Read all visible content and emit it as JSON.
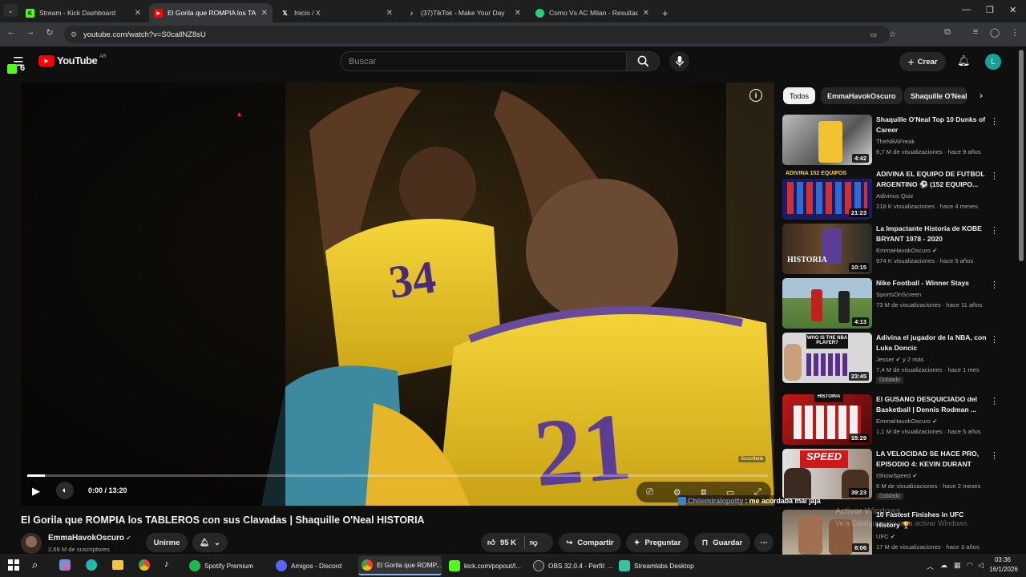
{
  "browser": {
    "tabs": [
      {
        "title": "Stream - Kick Dashboard",
        "icon": "kick-icon",
        "color": "#53fc18"
      },
      {
        "title": "El Gorila que ROMPIA los TABLE",
        "icon": "youtube-icon",
        "color": "#ff0000"
      },
      {
        "title": "Inicio / X",
        "icon": "x-icon",
        "color": "#ffffff"
      },
      {
        "title": "(37)TikTok - Make Your Day",
        "icon": "tiktok-icon",
        "color": "#ffffff"
      },
      {
        "title": "Como Vs AC Milan - Resultado",
        "icon": "soccer-icon",
        "color": "#2ecc71"
      }
    ],
    "url": "youtube.com/watch?v=S0callNZ8sU"
  },
  "youtube": {
    "logo_text": "YouTube",
    "region": "AR",
    "kick_badge": "6",
    "search_placeholder": "Buscar",
    "create_label": "Crear",
    "avatar_letter": "L"
  },
  "player": {
    "time": "0:00 / 13:20",
    "subscribe_watermark": "Suscribete"
  },
  "video": {
    "title": "El Gorila que ROMPIA los TABLEROS con sus Clavadas | Shaquille O'Neal HISTORIA",
    "channel": "EmmaHavokOscuro",
    "subscribers": "2,69 M de suscriptores",
    "join_label": "Unirme",
    "likes": "95 K",
    "share_label": "Compartir",
    "ask_label": "Preguntar",
    "save_label": "Guardar"
  },
  "chips": [
    "Todos",
    "EmmaHavokOscuro",
    "Shaquille O'Neal"
  ],
  "recommendations": [
    {
      "title": "Shaquille O'Neal Top 10 Dunks of Career",
      "channel": "TheNBAFreak",
      "meta": "6,7 M de visualizaciones · hace 9 años",
      "duration": "4:42",
      "verified": false,
      "badge": ""
    },
    {
      "title": "ADIVINA EL EQUIPO DE FUTBOL ARGENTINO ⚽ (152 EQUIPO...",
      "channel": "Adivinus Quiz",
      "meta": "218 K visualizaciones · hace 4 meses",
      "duration": "21:23",
      "verified": false,
      "badge": ""
    },
    {
      "title": "La Impactante Historia de KOBE BRYANT 1978 - 2020",
      "channel": "EmmaHavokOscuro",
      "meta": "974 K visualizaciones · hace 5 años",
      "duration": "10:15",
      "verified": true,
      "badge": ""
    },
    {
      "title": "Nike Football  - Winner Stays",
      "channel": "SportsOnScreen",
      "meta": "73 M de visualizaciones · hace 11 años",
      "duration": "4:13",
      "verified": false,
      "badge": ""
    },
    {
      "title": "Adivina el jugador de la NBA, con Luka Doncic",
      "channel": "Jesser",
      "channel_extra": "y 2 más",
      "meta": "7,4 M de visualizaciones · hace 1 mes",
      "duration": "23:45",
      "verified": true,
      "badge": "Doblado"
    },
    {
      "title": "El GUSANO DESQUICIADO del Basketball | Dennis Rodman ...",
      "channel": "EmmaHavokOscuro",
      "meta": "1,1 M de visualizaciones · hace 5 años",
      "duration": "15:29",
      "verified": true,
      "badge": ""
    },
    {
      "title": "LA VELOCIDAD SE HACE PRO, EPISODIO 4: KEVIN DURANT",
      "channel": "IShowSpeed",
      "meta": "6 M de visualizaciones · hace 2 meses",
      "duration": "39:23",
      "verified": true,
      "badge": "Doblado"
    },
    {
      "title": "10 Fastest Finishes in UFC History 🏆",
      "channel": "UFC",
      "meta": "17 M de visualizaciones · hace 3 años",
      "duration": "8:06",
      "verified": true,
      "badge": ""
    }
  ],
  "thumb_text": {
    "adivina": "ADIVINA 152 EQUIPOS",
    "kobe": "HISTORIA",
    "nba_q": "WHO IS THE NBA PLAYER?",
    "rodman": "HISTORIA",
    "speed": "SPEED"
  },
  "overlays": {
    "chat_user": "Chilemiralopotty",
    "chat_msg": ": me acordaba mal jaja",
    "win_line1": "Activar Windows",
    "win_line2": "Ve a Configuración para activar Windows."
  },
  "taskbar": {
    "apps": [
      "Spotify Premium",
      "Amigos - Discord",
      "El Gorila que ROMP...",
      "kick.com/popout/l...",
      "OBS 32.0.4 - Perfil: ...",
      "Streamlabs Desktop"
    ],
    "time": "03:36",
    "date": "16/1/2026"
  },
  "colors": {
    "youtube_red": "#ff0000",
    "kick_green": "#53fc18",
    "avatar": "#1aa097"
  }
}
